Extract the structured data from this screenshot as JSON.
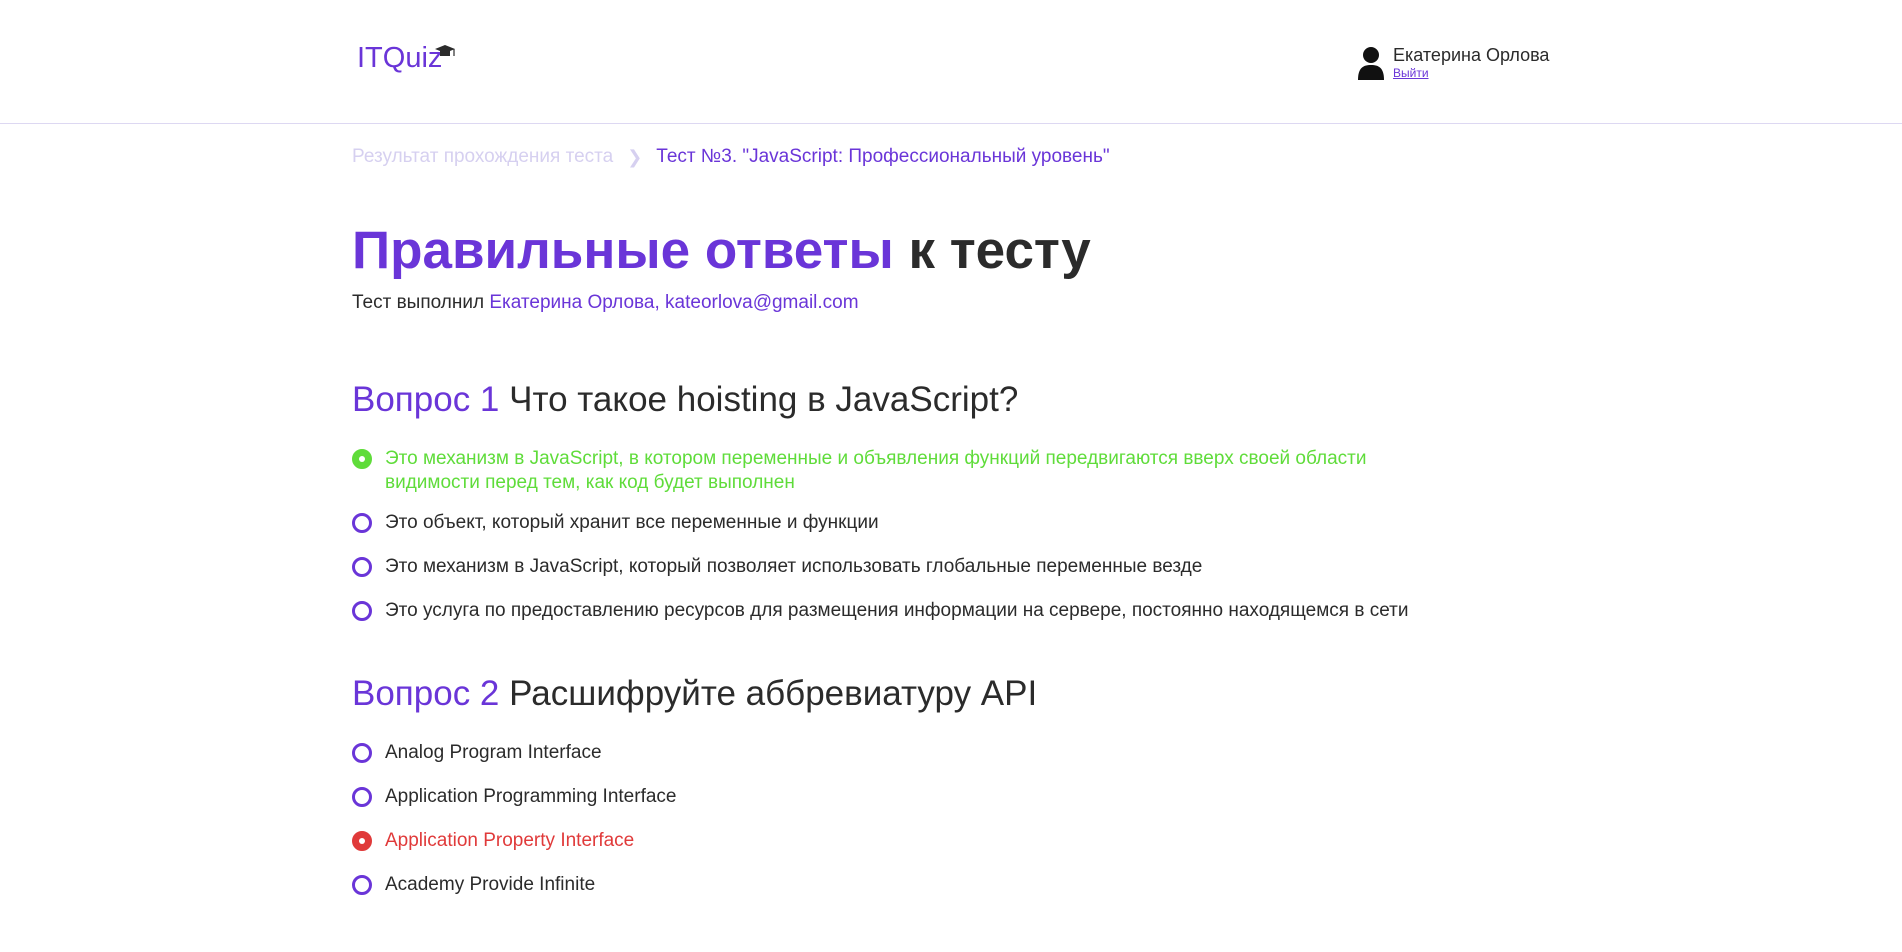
{
  "header": {
    "logo": "ITQuiz",
    "user_name": "Екатерина Орлова",
    "logout_label": "Выйти"
  },
  "breadcrumb": {
    "previous": "Результат прохождения теста",
    "current": "Тест №3. \"JavaScript: Профессиональный уровень\""
  },
  "title": {
    "accent": "Правильные ответы",
    "rest": "к тесту"
  },
  "subtitle": {
    "prefix": "Тест выполнил",
    "who": "Екатерина Орлова, kateorlova@gmail.com"
  },
  "questions": [
    {
      "number": "Вопрос 1",
      "text": "Что такое hoisting в JavaScript?",
      "answers": [
        {
          "text": "Это механизм в JavaScript, в котором переменные и объявления функций передвигаются вверх своей области видимости перед тем, как код будет выполнен",
          "state": "correct"
        },
        {
          "text": "Это объект, который хранит все переменные и функции",
          "state": "none"
        },
        {
          "text": "Это механизм в JavaScript, который позволяет использовать глобальные переменные везде",
          "state": "none"
        },
        {
          "text": "Это услуга по предоставлению ресурсов для размещения информации на сервере, постоянно находящемся в сети",
          "state": "none"
        }
      ]
    },
    {
      "number": "Вопрос 2",
      "text": "Расшифруйте аббревиатуру API",
      "answers": [
        {
          "text": "Analog Program Interface",
          "state": "none"
        },
        {
          "text": "Application Programming Interface",
          "state": "none"
        },
        {
          "text": "Application Property Interface",
          "state": "wrong"
        },
        {
          "text": "Academy Provide Infinite",
          "state": "none"
        }
      ]
    }
  ],
  "colors": {
    "accent": "#6a35d8",
    "correct": "#5fdc3a",
    "wrong": "#e03a3a",
    "breadcrumb_muted": "#d6d0f0",
    "text": "#2b2b2b"
  }
}
